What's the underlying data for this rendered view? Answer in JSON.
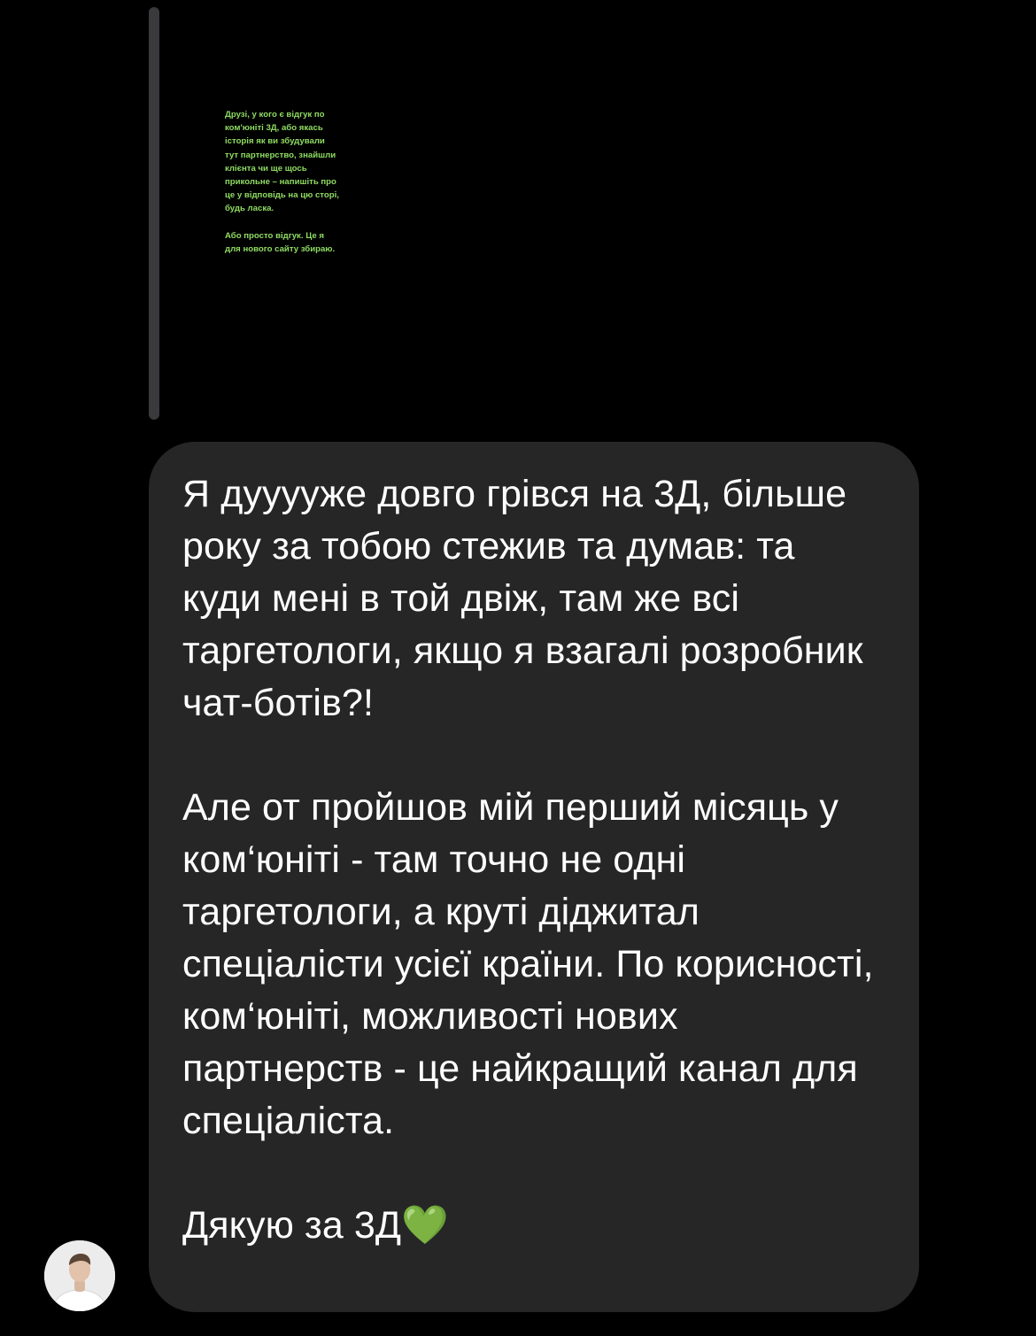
{
  "story": {
    "paragraphs": [
      "Друзі, у кого є відгук по ком'юніті 3Д, або якась історія як ви збудували тут партнерство, знайшли клієнта чи ще щось прикольне – напишіть про це у відповідь на цю сторі, будь ласка.",
      "Або просто відгук. Це я для нового сайту збираю."
    ]
  },
  "message": {
    "paragraph_1": "Я дууууже довго грівся на 3Д, більше року за тобою стежив та думав: та куди мені в той двіж, там же всі таргетологи, якщо я взагалі розробник чат-ботів?!",
    "paragraph_2": "Але от пройшов мій перший місяць у ком‘юніті - там точно не одні таргетологи, а круті діджитал спеціалісти усієї країни. По корисності, ком‘юніті, можливості нових партнерств - це найкращий канал для спеціаліста.",
    "paragraph_3": "Дякую за 3Д",
    "emoji": "💚"
  },
  "colors": {
    "background": "#000000",
    "bubble": "#262626",
    "story_text": "#8fdc62",
    "message_text": "#ffffff"
  },
  "icons": {
    "avatar": "sender-avatar"
  }
}
